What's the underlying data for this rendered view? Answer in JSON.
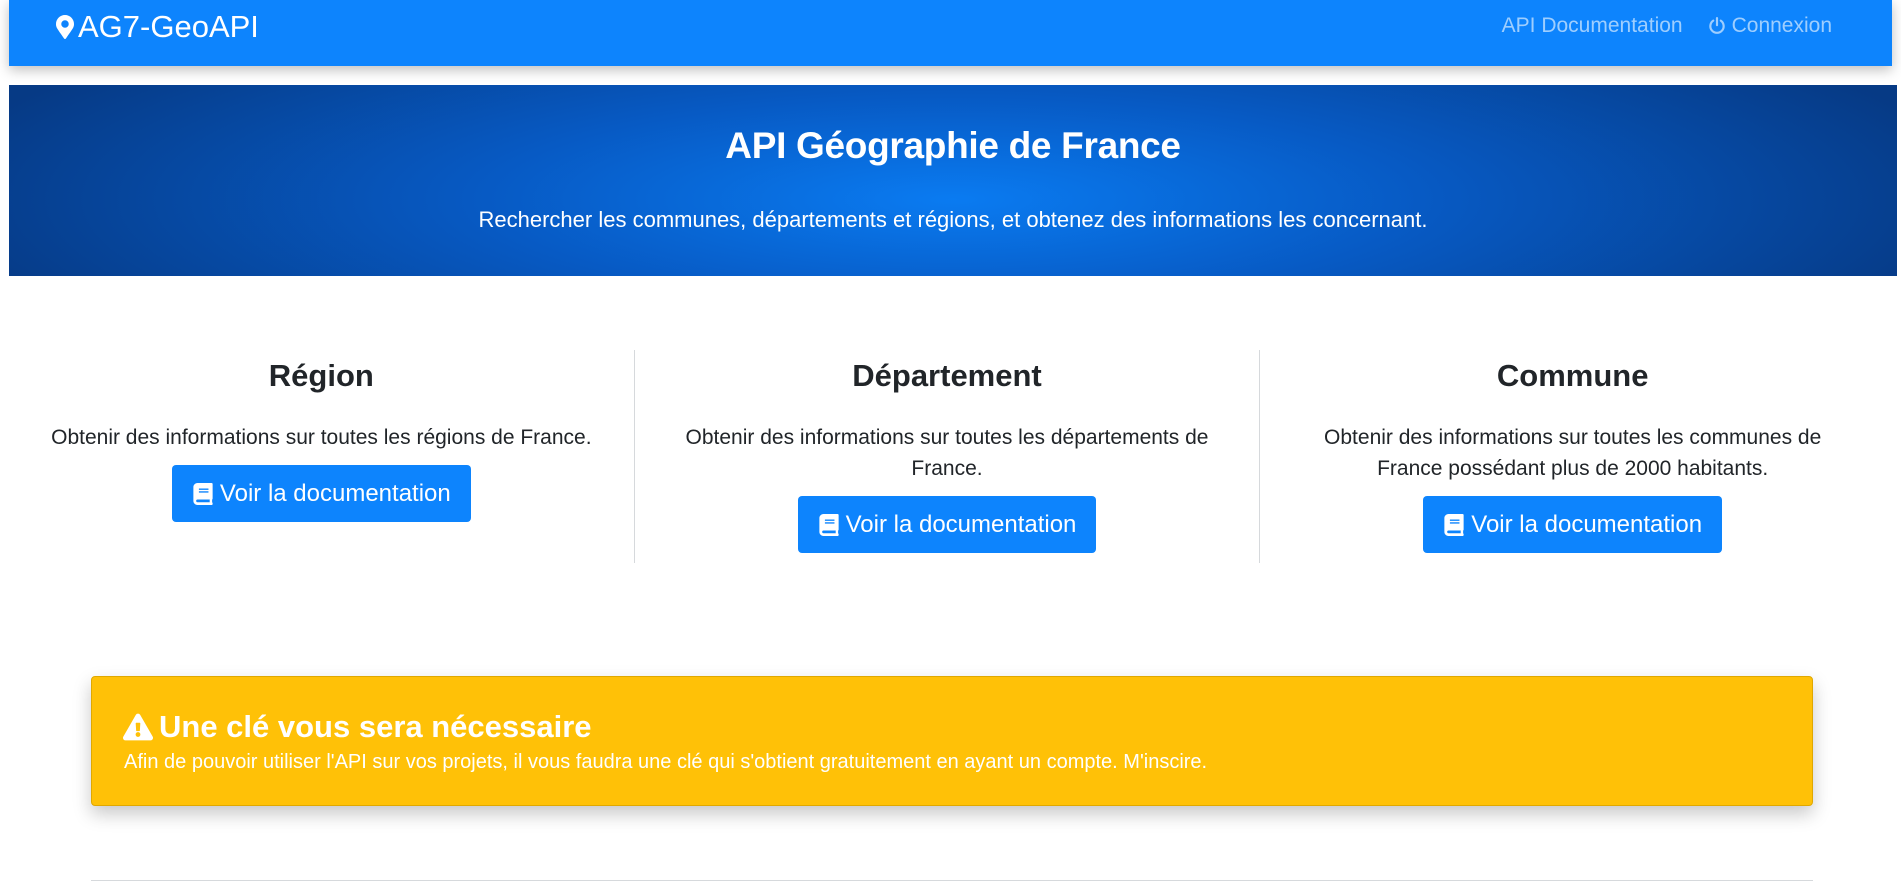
{
  "navbar": {
    "brand": "AG7-GeoAPI",
    "brand_icon": "map-marker-icon",
    "links": {
      "api_documentation": "API Documentation",
      "connexion": "Connexion",
      "connexion_icon": "power-icon"
    },
    "color": "#0d84fd"
  },
  "hero": {
    "title": "API Géographie de France",
    "subtitle": "Rechercher les communes, départements et régions, et obtenez des informations les concernant."
  },
  "sections": [
    {
      "title": "Région",
      "text": "Obtenir des informations sur toutes les régions de France.",
      "button": "Voir la documentation"
    },
    {
      "title": "Département",
      "text": "Obtenir des informations sur toutes les départements de France.",
      "button": "Voir la documentation"
    },
    {
      "title": "Commune",
      "text": "Obtenir des informations sur toutes les communes de France possédant plus de 2000 habitants.",
      "button": "Voir la documentation"
    }
  ],
  "button_icon": "book-icon",
  "alert": {
    "icon": "warning-icon",
    "title": "Une clé vous sera nécessaire",
    "text": "Afin de pouvoir utiliser l'API sur vos projets, il vous faudra une clé qui s'obtient gratuitement en ayant un compte. M'inscire.",
    "color": "#ffc107"
  }
}
